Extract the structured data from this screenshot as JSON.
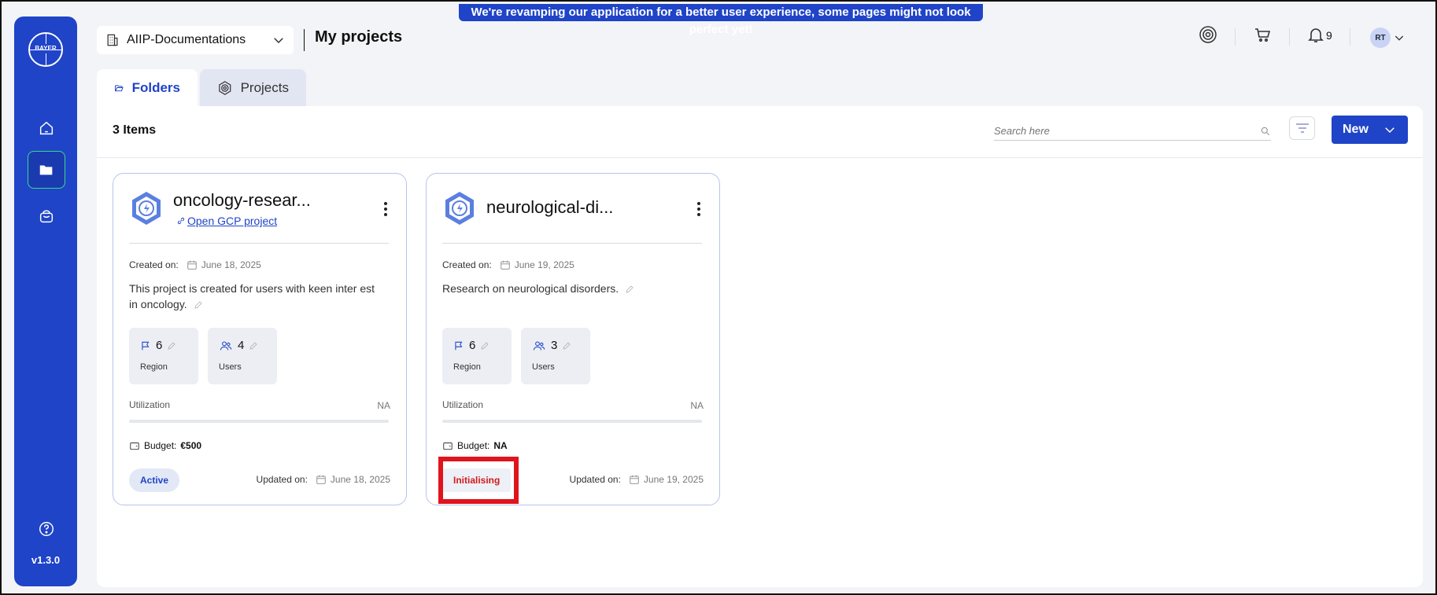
{
  "banner": "We're revamping our application for a better user experience, some pages might not look perfect yet!",
  "sidebar": {
    "logo_text": "BAYER",
    "version": "v1.3.0",
    "items": [
      {
        "icon": "home-icon"
      },
      {
        "icon": "folder-icon",
        "active": true
      },
      {
        "icon": "bag-icon"
      }
    ]
  },
  "header": {
    "workspace": "AIIP-Documentations",
    "title": "My projects",
    "notifications_count": "9",
    "avatar_initials": "RT"
  },
  "tabs": [
    {
      "label": "Folders",
      "active": true
    },
    {
      "label": "Projects",
      "active": false
    }
  ],
  "toolbar": {
    "items_count": "3 Items",
    "search_placeholder": "Search here",
    "new_label": "New"
  },
  "colors": {
    "accent": "#1f44c8",
    "error": "#d01c1c"
  },
  "cards": [
    {
      "name": "oncology-resear...",
      "link": "Open GCP project",
      "created_label": "Created on:",
      "created_date": "June 18, 2025",
      "description": "This project is created for users with keen inter est in oncology.",
      "region_count": "6",
      "region_label": "Region",
      "users_count": "4",
      "users_label": "Users",
      "utilization_label": "Utilization",
      "utilization_value": "NA",
      "budget_label": "Budget:",
      "budget_value": "€500",
      "status": "Active",
      "updated_label": "Updated on:",
      "updated_date": "June 18, 2025"
    },
    {
      "name": "neurological-di...",
      "created_label": "Created on:",
      "created_date": "June 19, 2025",
      "description": "Research on neurological disorders.",
      "region_count": "6",
      "region_label": "Region",
      "users_count": "3",
      "users_label": "Users",
      "utilization_label": "Utilization",
      "utilization_value": "NA",
      "budget_label": "Budget:",
      "budget_value": "NA",
      "status": "Initialising",
      "updated_label": "Updated on:",
      "updated_date": "June 19, 2025"
    }
  ]
}
